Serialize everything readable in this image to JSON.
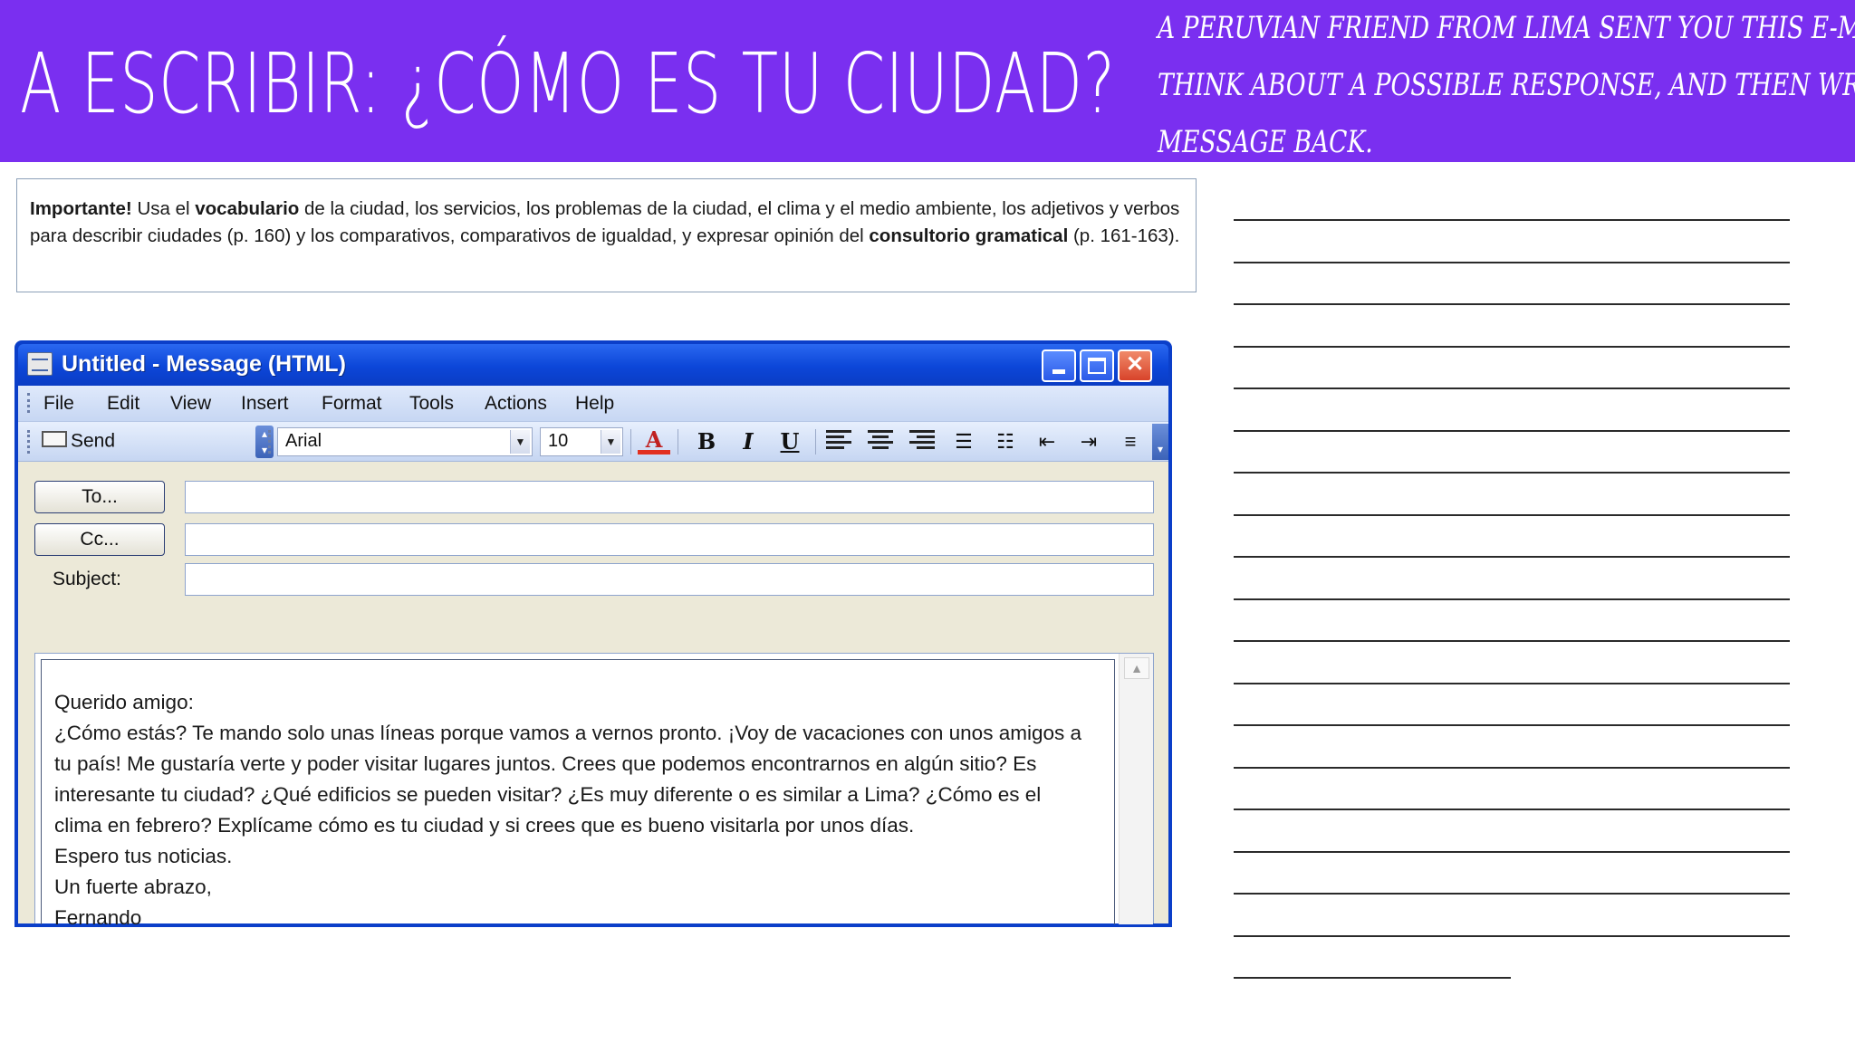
{
  "header": {
    "title": "A escribir: ¿Cómo es tu ciudad?",
    "instructions": [
      "A Peruvian friend from Lima sent you this e-mail.",
      "Think about a possible response, and then write a",
      "message back."
    ],
    "background_color": "#7a2ff0"
  },
  "important": {
    "lead": "Importante!",
    "part1": " Usa el ",
    "vocab": "vocabulario",
    "part2": "  de la ciudad, los servicios, los problemas de la ciudad, el clima y el medio ambiente, los adjetivos y verbos para describir ciudades (p. 160) y los comparativos, comparativos de igualdad, y expresar opinión del ",
    "consult": "consultorio gramatical",
    "part3": " (p. 161-163)."
  },
  "email_window": {
    "title": "Untitled - Message (HTML)",
    "menu": [
      "File",
      "Edit",
      "View",
      "Insert",
      "Format",
      "Tools",
      "Actions",
      "Help"
    ],
    "toolbar": {
      "send_label": "Send",
      "font": "Arial",
      "size": "10",
      "bold": "B",
      "italic": "I",
      "underline": "U",
      "font_color_glyph": "A"
    },
    "fields": {
      "to_label": "To...",
      "cc_label": "Cc...",
      "subject_label": "Subject:"
    },
    "body_lines": [
      "Querido amigo:",
      "¿Cómo estás? Te mando solo unas líneas porque vamos a vernos pronto.  ¡Voy de vacaciones con unos amigos a",
      "tu país! Me gustaría verte y poder visitar lugares juntos. Crees que podemos  encontrarnos  en algún sitio? Es",
      "interesante tu ciudad? ¿Qué edificios se pueden visitar? ¿Es muy diferente o es similar a Lima? ¿Cómo es el",
      "clima en febrero? Explícame cómo  es tu ciudad y si crees que es bueno visitarla por unos días.",
      "Espero tus noticias.",
      "Un fuerte abrazo,",
      "Fernando"
    ]
  }
}
